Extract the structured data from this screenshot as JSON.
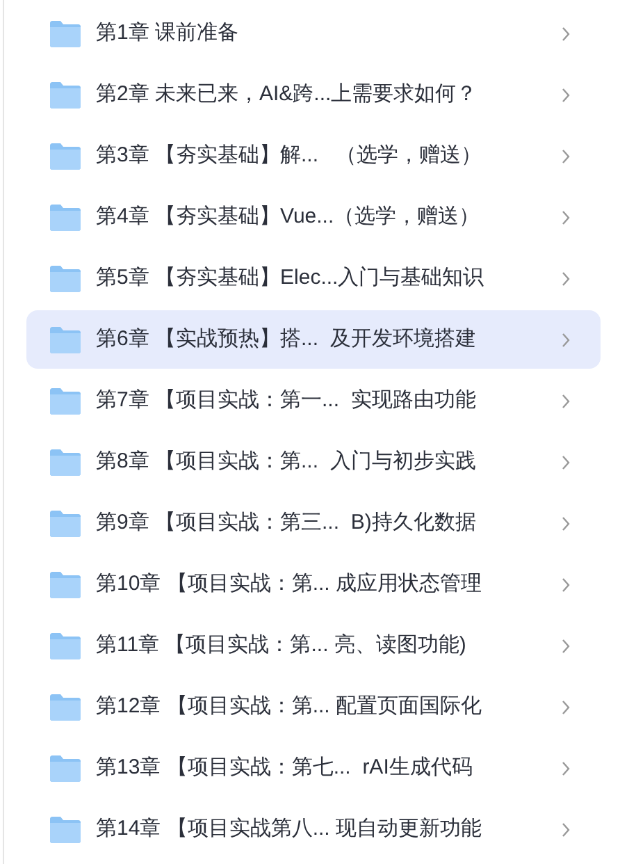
{
  "chapters": [
    {
      "title": "第1章 课前准备",
      "selected": false
    },
    {
      "title": "第2章 未来已来，AI&跨...上需要求如何？",
      "selected": false
    },
    {
      "title": "第3章 【夯实基础】解...   （选学，赠送）",
      "selected": false
    },
    {
      "title": "第4章 【夯实基础】Vue...（选学，赠送）",
      "selected": false
    },
    {
      "title": "第5章 【夯实基础】Elec...入门与基础知识",
      "selected": false
    },
    {
      "title": "第6章 【实战预热】搭...  及开发环境搭建",
      "selected": true
    },
    {
      "title": "第7章 【项目实战：第一...  实现路由功能",
      "selected": false
    },
    {
      "title": "第8章 【项目实战：第...  入门与初步实践",
      "selected": false
    },
    {
      "title": "第9章 【项目实战：第三...  B)持久化数据",
      "selected": false
    },
    {
      "title": "第10章 【项目实战：第... 成应用状态管理",
      "selected": false
    },
    {
      "title": "第11章 【项目实战：第... 亮、读图功能)",
      "selected": false
    },
    {
      "title": "第12章 【项目实战：第... 配置页面国际化",
      "selected": false
    },
    {
      "title": "第13章 【项目实战：第七...  rAI生成代码",
      "selected": false
    },
    {
      "title": "第14章 【项目实战第八... 现自动更新功能",
      "selected": false
    }
  ]
}
